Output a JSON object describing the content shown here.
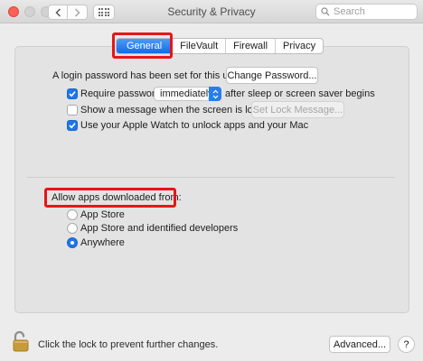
{
  "window": {
    "title": "Security & Privacy"
  },
  "search": {
    "placeholder": "Search"
  },
  "tabs": [
    {
      "label": "General",
      "active": true
    },
    {
      "label": "FileVault",
      "active": false
    },
    {
      "label": "Firewall",
      "active": false
    },
    {
      "label": "Privacy",
      "active": false
    }
  ],
  "general": {
    "login_password_text": "A login password has been set for this user",
    "change_password_button": "Change Password...",
    "require_password_label": "Require password",
    "require_password_checked": true,
    "require_password_delay": "immediately",
    "after_sleep_text": "after sleep or screen saver begins",
    "show_message_label": "Show a message when the screen is locked",
    "show_message_checked": false,
    "set_lock_message_button": "Set Lock Message...",
    "apple_watch_label": "Use your Apple Watch to unlock apps and your Mac",
    "apple_watch_checked": true
  },
  "allow_apps": {
    "heading": "Allow apps downloaded from:",
    "options": [
      {
        "label": "App Store",
        "selected": false
      },
      {
        "label": "App Store and identified developers",
        "selected": false
      },
      {
        "label": "Anywhere",
        "selected": true
      }
    ]
  },
  "footer": {
    "lock_text": "Click the lock to prevent further changes.",
    "advanced_button": "Advanced...",
    "help_label": "?"
  },
  "colors": {
    "accent": "#1f76ea",
    "highlight_box": "#e5161a",
    "close_light": "#fc5f57"
  }
}
